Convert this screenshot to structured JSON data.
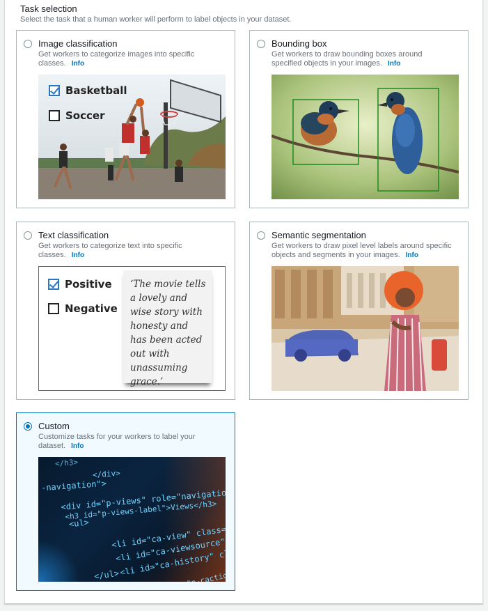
{
  "section": {
    "title": "Task selection",
    "description": "Select the task that a human worker will perform to label objects in your dataset."
  },
  "info_label": "Info",
  "cards": {
    "image_classification": {
      "title": "Image classification",
      "description": "Get workers to categorize images into specific classes.",
      "selected": false,
      "options": [
        {
          "label": "Basketball",
          "checked": true
        },
        {
          "label": "Soccer",
          "checked": false
        }
      ]
    },
    "bounding_box": {
      "title": "Bounding box",
      "description": "Get workers to draw bounding boxes around specified objects in your images.",
      "selected": false
    },
    "text_classification": {
      "title": "Text classification",
      "description": "Get workers to categorize text into specific classes.",
      "selected": false,
      "options": [
        {
          "label": "Positive",
          "checked": true
        },
        {
          "label": "Negative",
          "checked": false
        }
      ],
      "quote": "‘The movie tells a lovely and wise story with honesty and has been acted out with unassuming grace.’"
    },
    "semantic_segmentation": {
      "title": "Semantic segmentation",
      "description": "Get workers to draw pixel level labels around specific objects and segments in your images.",
      "selected": false
    },
    "custom": {
      "title": "Custom",
      "description": "Customize tasks for your workers to label your dataset.",
      "selected": true,
      "code_lines": [
        "</h3>",
        "</div>",
        "-navigation\">",
        "<div id=\"p-views\" role=\"navigation\" class",
        "<h3 id=\"p-views-label\">Views</h3>",
        "<ul>",
        "<li id=\"ca-view\" class=\"collapsible",
        "<li id=\"ca-viewsource\" class=\"",
        "<li id=\"ca-history\" class=\"",
        "</ul>",
        "<li id=\"p-cactions\" role=\"na"
      ]
    }
  },
  "colors": {
    "accent": "#0073bb",
    "selected_bg": "#f1faff",
    "bbox_green": "#1e8a1e"
  }
}
